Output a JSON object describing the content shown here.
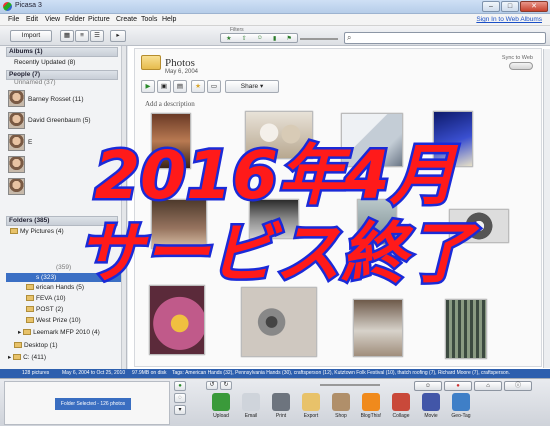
{
  "window": {
    "title": "Picasa 3"
  },
  "menu": {
    "items": [
      "File",
      "Edit",
      "View",
      "Folder",
      "Picture",
      "Create",
      "Tools",
      "Help"
    ],
    "signin": "Sign In to Web Albums"
  },
  "toolbar": {
    "import_label": "Import",
    "filters_label": "Filters"
  },
  "left_panel": {
    "albums_header": "Albums (1)",
    "recently_updated": "Recently Updated (8)",
    "people_header": "People (7)",
    "unnamed": "Unnamed (37)",
    "people": [
      {
        "name": "Barney Rosset (11)"
      },
      {
        "name": "David Greenbaum (5)"
      },
      {
        "name": "E"
      },
      {
        "name": ""
      },
      {
        "name": ""
      }
    ],
    "folders_header": "Folders (385)",
    "my_pictures": "My Pictures (4)",
    "folders": [
      {
        "label": "(359)"
      },
      {
        "label": "erican Hands (5)"
      },
      {
        "label": "FEVA (10)"
      },
      {
        "label": "POST (2)"
      },
      {
        "label": "West Prize (10)"
      },
      {
        "label": "Leemark MFP 2010 (4)"
      },
      {
        "label": "Desktop (1)"
      },
      {
        "label": "C: (411)"
      }
    ],
    "selected_folder": "s (323)"
  },
  "album": {
    "title": "Photos",
    "date": "May 6, 2004",
    "sync_label": "Sync to Web",
    "share_label": "Share",
    "add_description": "Add a description"
  },
  "status_bar": {
    "count": "128 pictures",
    "dates": "May 6, 2004 to Oct 25, 2010",
    "size": "97.9MB on disk",
    "tags": "Tags: American Hands (32), Pennsylvania Hands (30), craftsperson (12), Kutztown Folk Festival (10), thatch roofing (7), Richard Moore (7), craftsperson."
  },
  "tray": {
    "selection_label": "Folder Selected - 126 photos",
    "tools": [
      {
        "label": "Upload",
        "color": "#3a9a3a"
      },
      {
        "label": "Email",
        "color": "#cfd4db"
      },
      {
        "label": "Print",
        "color": "#6d747e"
      },
      {
        "label": "Export",
        "color": "#e8c26a"
      },
      {
        "label": "Shop",
        "color": "#b08f6a"
      },
      {
        "label": "BlogThis!",
        "color": "#f08a1c"
      },
      {
        "label": "Collage",
        "color": "#c9493a"
      },
      {
        "label": "Movie",
        "color": "#4256a8"
      },
      {
        "label": "Geo-Tag",
        "color": "#3f7fc7"
      }
    ]
  },
  "overlay": {
    "line1": "2016年4月",
    "line2": "サービス終了",
    "fill": "#ff1a1a",
    "stroke": "#1a2ad8"
  }
}
